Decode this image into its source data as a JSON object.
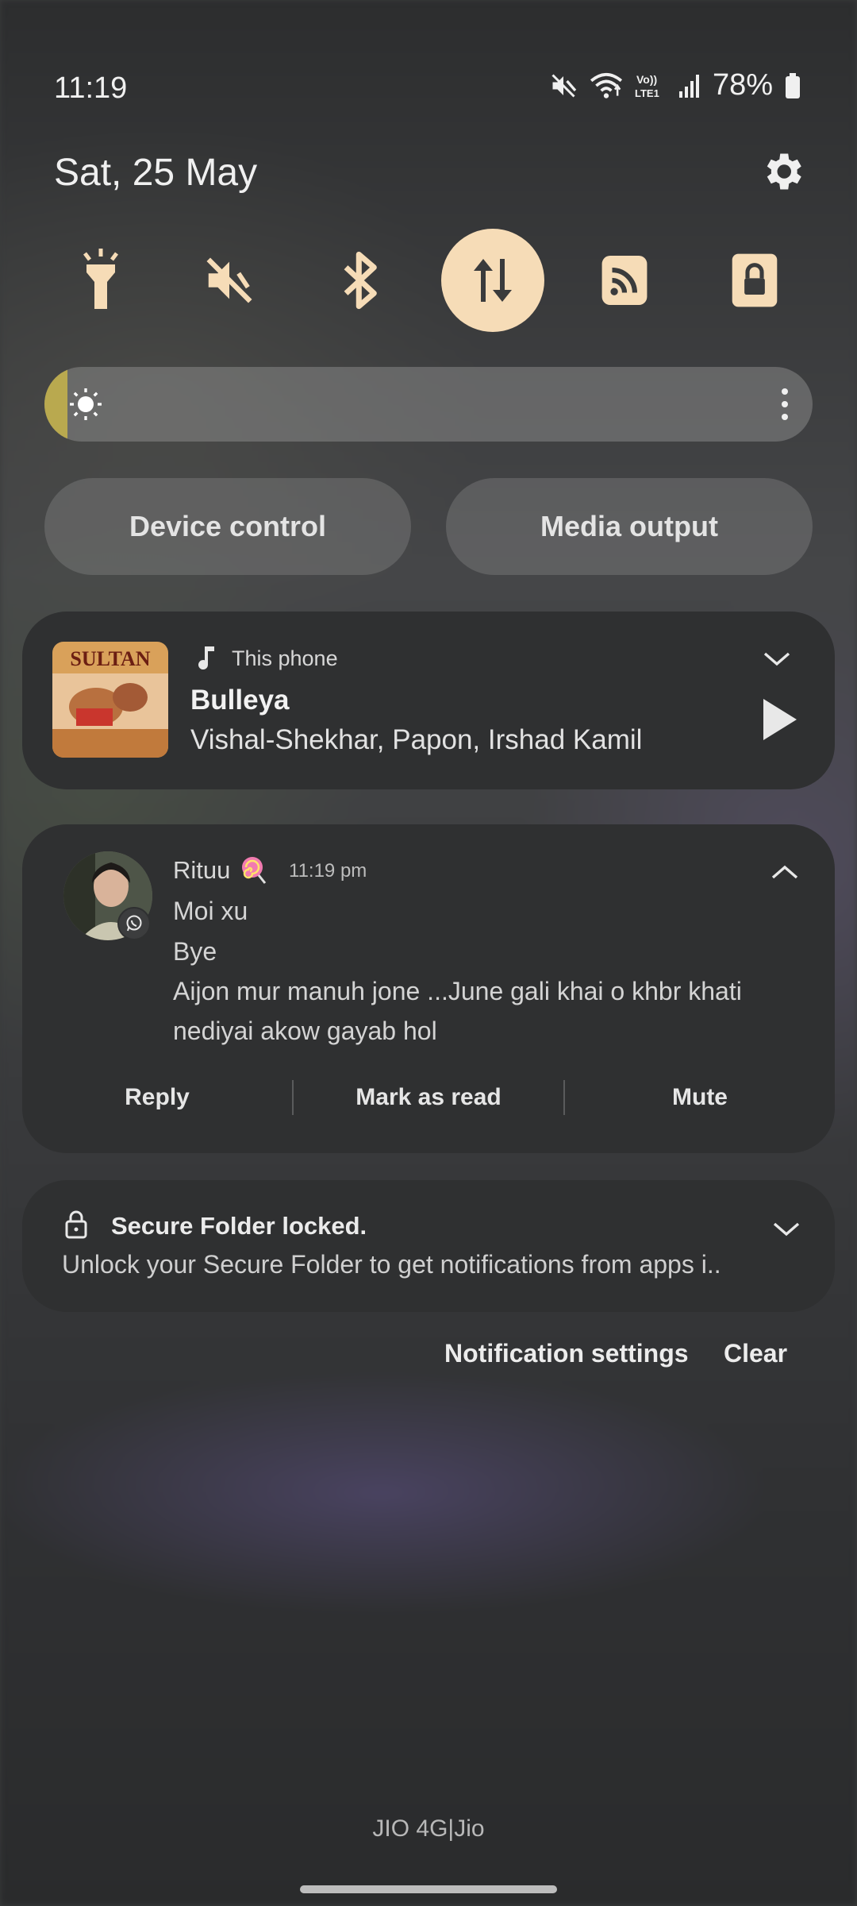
{
  "status_bar": {
    "time": "11:19",
    "battery": "78%",
    "network_label": "VoLTE1",
    "icons": [
      "mute-icon",
      "wifi-icon",
      "volte-icon",
      "signal-icon",
      "battery-icon"
    ]
  },
  "header": {
    "date": "Sat, 25 May"
  },
  "quick_toggles": [
    {
      "name": "flashlight",
      "active": false
    },
    {
      "name": "sound-mute",
      "active": false
    },
    {
      "name": "bluetooth",
      "active": false
    },
    {
      "name": "mobile-data",
      "active": true
    },
    {
      "name": "cast",
      "active": false
    },
    {
      "name": "secure-folder",
      "active": false
    }
  ],
  "brightness": {
    "level": 0.03
  },
  "buttons": {
    "device_control": "Device control",
    "media_output": "Media output"
  },
  "media": {
    "source": "This phone",
    "title": "Bulleya",
    "artists": "Vishal-Shekhar, Papon, Irshad Kamil",
    "album_art_text": "SULTAN"
  },
  "message": {
    "sender": "Rituu",
    "time": "11:19 pm",
    "lines": [
      "Moi xu",
      "Bye",
      "Aijon mur manuh jone ...June gali khai o khbr khati",
      "nediyai akow gayab hol"
    ],
    "actions": {
      "reply": "Reply",
      "mark_read": "Mark as read",
      "mute": "Mute"
    }
  },
  "secure_folder": {
    "title": "Secure Folder locked.",
    "text": "Unlock your Secure Folder to get notifications from apps i.."
  },
  "footer": {
    "notification_settings": "Notification settings",
    "clear": "Clear",
    "carrier": "JIO 4G|Jio"
  },
  "colors": {
    "toggle_icon": "#f6dcb7",
    "toggle_active_bg": "#f6dcb7",
    "card_bg": "#2f3031",
    "brightness_fill": "#b9a94f"
  }
}
